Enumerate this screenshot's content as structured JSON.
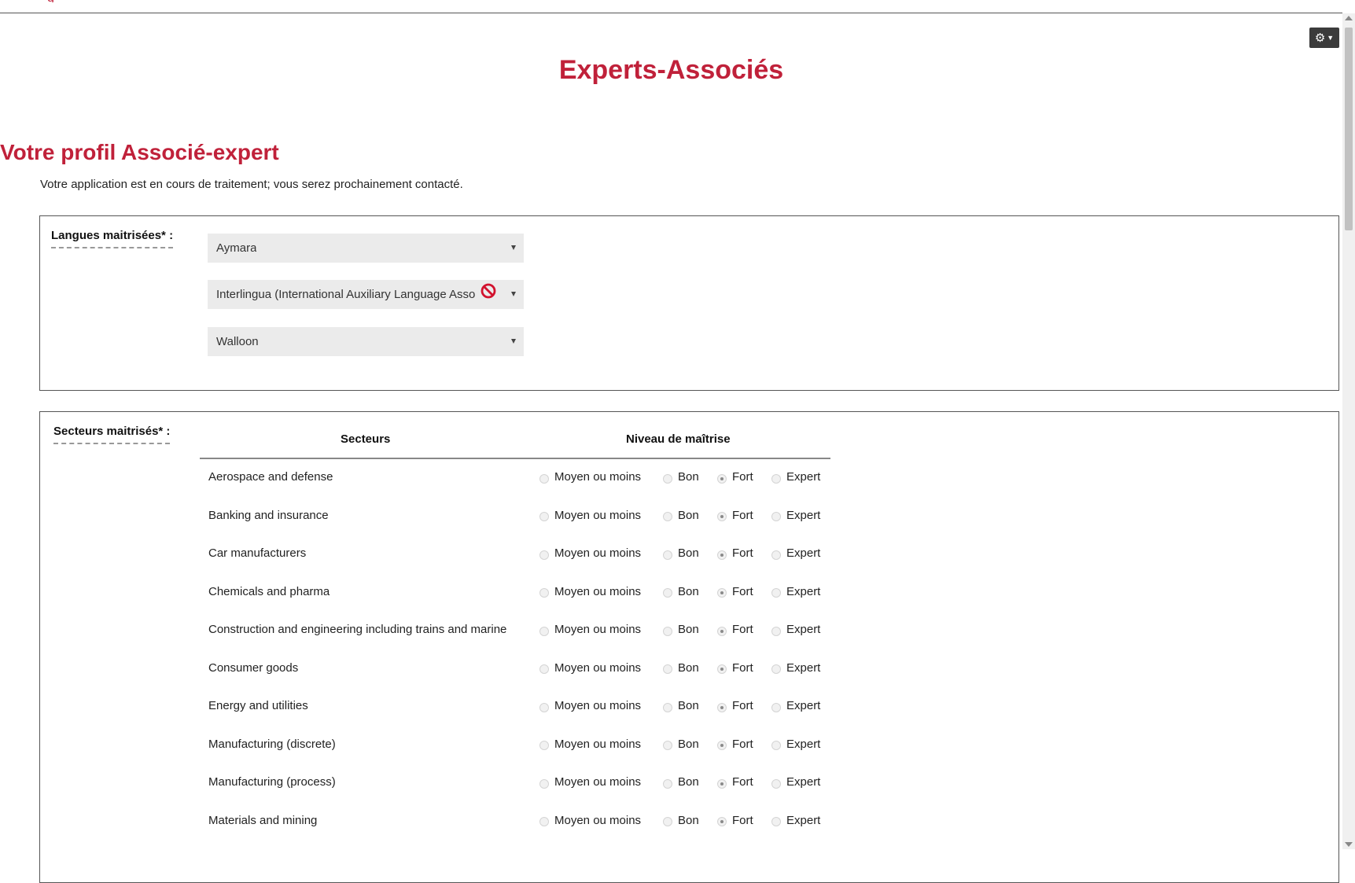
{
  "header": {
    "fragment": "g",
    "settings_icon": "gear-icon"
  },
  "page_title": "Experts-Associés",
  "profile": {
    "title": "Votre profil Associé-expert",
    "status": "Votre application est en cours de traitement; vous serez prochainement contacté."
  },
  "languages": {
    "label": "Langues maitrisées* :",
    "selects": [
      {
        "value": "Aymara"
      },
      {
        "value": "Interlingua (International Auxiliary Language Asso"
      },
      {
        "value": "Walloon"
      }
    ]
  },
  "sectors": {
    "label": "Secteurs maitrisés* :",
    "col_sector": "Secteurs",
    "col_level": "Niveau de maîtrise",
    "options": [
      "Moyen ou moins",
      "Bon",
      "Fort",
      "Expert"
    ],
    "rows": [
      {
        "name": "Aerospace and defense",
        "selected": 2
      },
      {
        "name": "Banking and insurance",
        "selected": 2
      },
      {
        "name": "Car manufacturers",
        "selected": 2
      },
      {
        "name": "Chemicals and pharma",
        "selected": 2
      },
      {
        "name": "Construction and engineering including trains and marine",
        "selected": 2
      },
      {
        "name": "Consumer goods",
        "selected": 2
      },
      {
        "name": "Energy and utilities",
        "selected": 2
      },
      {
        "name": "Manufacturing (discrete)",
        "selected": 2
      },
      {
        "name": "Manufacturing (process)",
        "selected": 2
      },
      {
        "name": "Materials and mining",
        "selected": 2
      }
    ]
  },
  "colors": {
    "accent": "#c0213a",
    "panel_border": "#555555",
    "select_bg": "#ebebeb"
  }
}
